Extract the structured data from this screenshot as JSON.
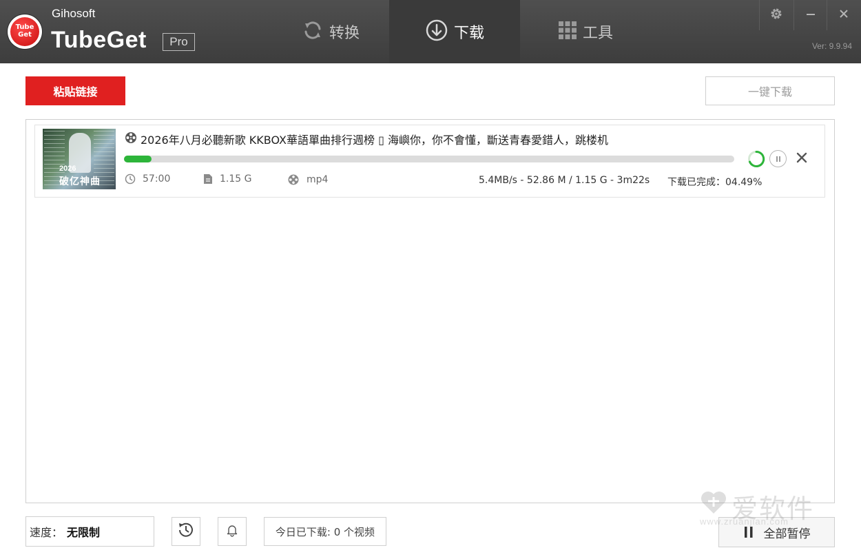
{
  "app": {
    "brand_top": "Gihosoft",
    "brand_main": "TubeGet",
    "edition": "Pro",
    "version": "Ver: 9.9.94",
    "logo_line1": "Tube",
    "logo_line2": "Get"
  },
  "tabs": [
    {
      "label": "转换",
      "icon": "refresh-icon",
      "active": false
    },
    {
      "label": "下载",
      "icon": "download-circle-icon",
      "active": true
    },
    {
      "label": "工具",
      "icon": "grid-icon",
      "active": false
    }
  ],
  "toolbar": {
    "paste_label": "粘贴链接",
    "onekey_label": "一键下载"
  },
  "downloads": [
    {
      "title": "2026年八月必聽新歌  KKBOX華語單曲排行週榜 ▯ 海嶼你，你不會懂，斷送青春愛錯人，跳楼机",
      "thumb_year": "2026",
      "thumb_caption": "破亿神曲",
      "duration": "57:00",
      "size": "1.15 G",
      "format": "mp4",
      "stats": "5.4MB/s - 52.86 M / 1.15 G - 3m22s",
      "done_text": "下载已完成：04.49%",
      "progress": 0.0449
    }
  ],
  "footer": {
    "speed_label": "速度：",
    "speed_value": "无限制",
    "today_text": "今日已下载: 0 个视频",
    "pause_all_label": "全部暂停"
  },
  "watermark": {
    "text": "爱软件",
    "sub": "www.zruanjian.com"
  },
  "colors": {
    "accent_red": "#e02020",
    "progress_green": "#2db53a",
    "header_dark": "#454545"
  }
}
